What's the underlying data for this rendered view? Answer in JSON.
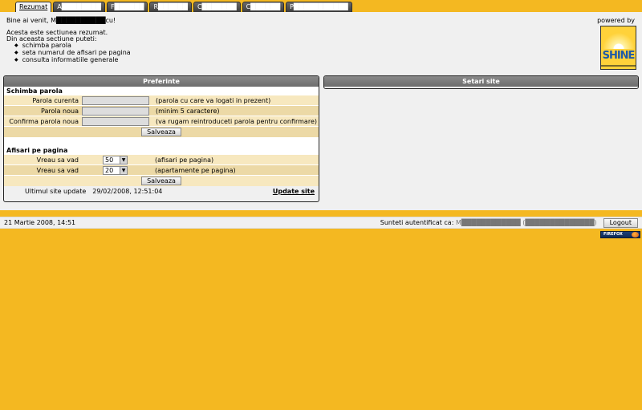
{
  "tabs": [
    {
      "label": "Rezumat",
      "active": true
    },
    {
      "label": "A████████",
      "active": false
    },
    {
      "label": "F██████",
      "active": false
    },
    {
      "label": "R██████",
      "active": false
    },
    {
      "label": "C███████",
      "active": false
    },
    {
      "label": "C██████",
      "active": false
    },
    {
      "label": "P███████████",
      "active": false
    }
  ],
  "welcome": "Bine ai venit, M██████████cu!",
  "intro": {
    "line1": "Acesta este sectiunea rezumat.",
    "line2": "Din aceasta sectiune puteti:",
    "items": [
      "schimba parola",
      "seta numarul de afisari pe pagina",
      "consulta informatiile generale"
    ]
  },
  "powered_by": "powered by",
  "logo_text": "SHINE",
  "preferinte": {
    "header": "Preferinte",
    "parola": {
      "title": "Schimba parola",
      "rows": [
        {
          "label": "Parola curenta",
          "hint": "(parola cu care va logati in prezent)"
        },
        {
          "label": "Parola noua",
          "hint": "(minim 5 caractere)"
        },
        {
          "label": "Confirma parola noua",
          "hint": "(va rugam reintroduceti parola pentru confirmare)"
        }
      ],
      "save": "Salveaza"
    },
    "afisari": {
      "title": "Afisari pe pagina",
      "rows": [
        {
          "label": "Vreau sa vad",
          "value": "50",
          "hint": "(afisari pe pagina)"
        },
        {
          "label": "Vreau sa vad",
          "value": "20",
          "hint": "(apartamente pe pagina)"
        }
      ],
      "save": "Salveaza"
    },
    "last_update_label": "Ultimul site update",
    "last_update_value": "29/02/2008, 12:51:04",
    "update_link": "Update site"
  },
  "setari": {
    "header": "Setari site"
  },
  "status": {
    "datetime": "21 Martie 2008, 14:51",
    "auth_label": "Sunteti autentificat ca:",
    "auth_user": "M████████████ (██████████████)",
    "logout": "Logout"
  },
  "badge": "FIREFOX",
  "colors": {
    "background": "#f4b821",
    "panel_header": "#7a7a7a",
    "row": "#f7e8bf"
  }
}
